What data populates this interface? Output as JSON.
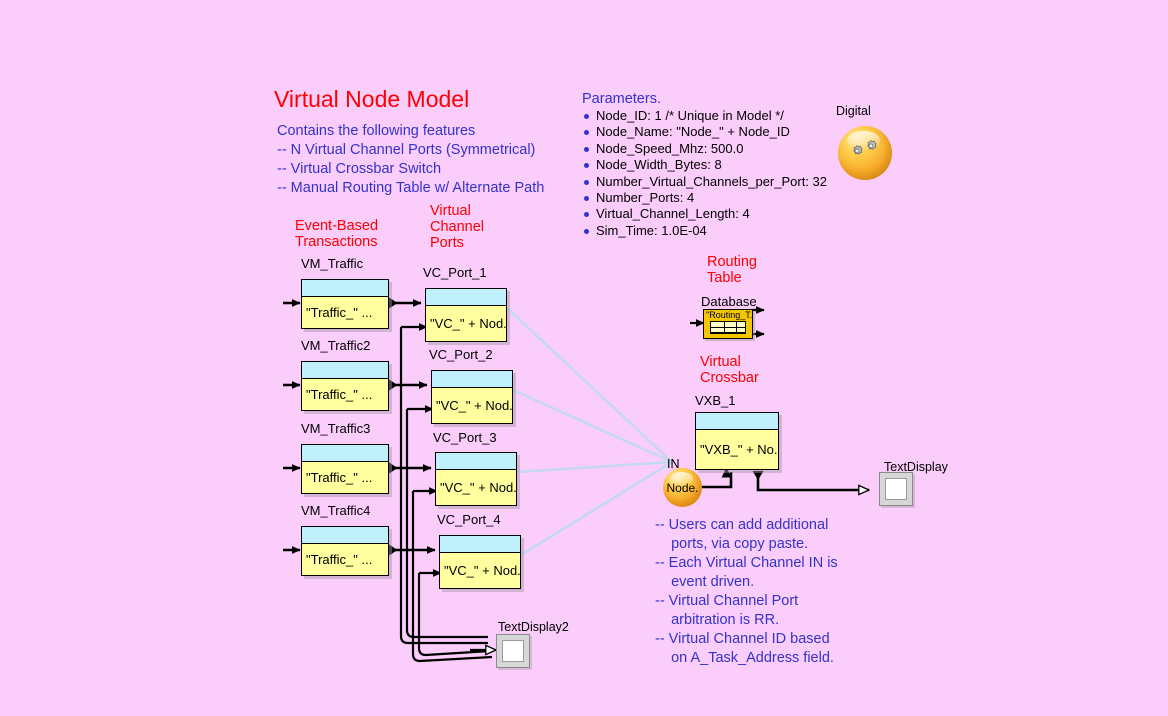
{
  "canvas": {
    "background": "#fbcdfb",
    "accent_red": "#ff0000",
    "accent_blue": "#3333cc",
    "block_body": "#ffffa0",
    "block_header": "#bff0fb"
  },
  "title": "Virtual Node Model",
  "features": "Contains the following features\n-- N Virtual Channel Ports (Symmetrical)\n-- Virtual Crossbar Switch\n-- Manual Routing Table w/ Alternate Path",
  "parameters": {
    "heading": "Parameters.",
    "items": [
      "Node_ID: 1 /* Unique in Model */",
      "Node_Name: \"Node_\" + Node_ID",
      "Node_Speed_Mhz: 500.0",
      "Node_Width_Bytes: 8",
      "Number_Virtual_Channels_per_Port: 32",
      "Number_Ports: 4",
      "Virtual_Channel_Length: 4",
      "Sim_Time: 1.0E-04"
    ]
  },
  "digital": {
    "label": "Digital"
  },
  "sections": {
    "event_based": "Event-Based\nTransactions",
    "virtual_channel_ports": "Virtual\nChannel\nPorts",
    "routing_table": "Routing\nTable",
    "virtual_crossbar": "Virtual\nCrossbar"
  },
  "traffic_blocks": [
    {
      "label": "VM_Traffic",
      "text": "\"Traffic_\" ..."
    },
    {
      "label": "VM_Traffic2",
      "text": "\"Traffic_\" ..."
    },
    {
      "label": "VM_Traffic3",
      "text": "\"Traffic_\" ..."
    },
    {
      "label": "VM_Traffic4",
      "text": "\"Traffic_\" ..."
    }
  ],
  "port_blocks": [
    {
      "label": "VC_Port_1",
      "text": "\"VC_\" + Nod..."
    },
    {
      "label": "VC_Port_2",
      "text": "\"VC_\" + Nod..."
    },
    {
      "label": "VC_Port_3",
      "text": "\"VC_\" + Nod..."
    },
    {
      "label": "VC_Port_4",
      "text": "\"VC_\" + Nod..."
    }
  ],
  "database": {
    "label": "Database",
    "text": "\"Routing_T."
  },
  "vxb": {
    "label": "VXB_1",
    "text": "\"VXB_\" + No..."
  },
  "in_node": {
    "label": "IN",
    "text": "Node."
  },
  "displays": [
    {
      "label": "TextDisplay"
    },
    {
      "label": "TextDisplay2"
    }
  ],
  "notes": "-- Users can add additional\n    ports, via copy paste.\n-- Each Virtual Channel IN is\n    event driven.\n-- Virtual Channel Port\n    arbitration is RR.\n-- Virtual Channel ID based\n    on A_Task_Address field."
}
